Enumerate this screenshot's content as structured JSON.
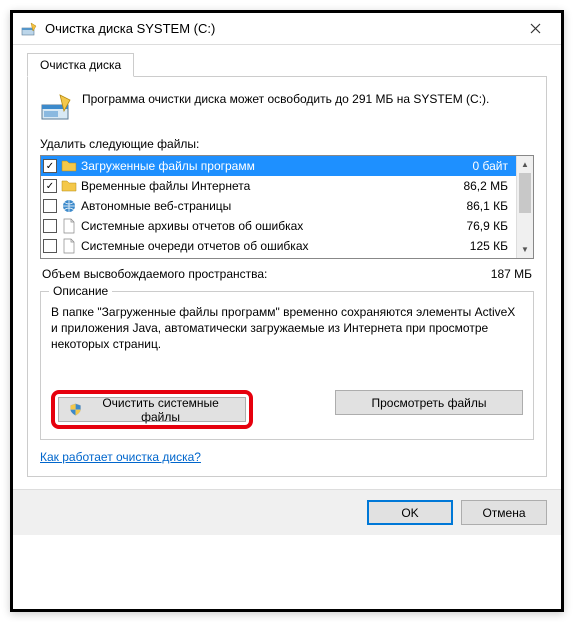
{
  "title": "Очистка диска SYSTEM (C:)",
  "tab_label": "Очистка диска",
  "intro": "Программа очистки диска может освободить до 291 МБ на SYSTEM (C:).",
  "files_label": "Удалить следующие файлы:",
  "files": [
    {
      "checked": true,
      "selected": true,
      "name": "Загруженные файлы программ",
      "size": "0 байт",
      "icon": "folder"
    },
    {
      "checked": true,
      "selected": false,
      "name": "Временные файлы Интернета",
      "size": "86,2 МБ",
      "icon": "folder"
    },
    {
      "checked": false,
      "selected": false,
      "name": "Автономные веб-страницы",
      "size": "86,1 КБ",
      "icon": "web"
    },
    {
      "checked": false,
      "selected": false,
      "name": "Системные архивы отчетов об ошибках",
      "size": "76,9 КБ",
      "icon": "file"
    },
    {
      "checked": false,
      "selected": false,
      "name": "Системные очереди отчетов об ошибках",
      "size": "125 КБ",
      "icon": "file"
    }
  ],
  "total_label": "Объем высвобождаемого пространства:",
  "total_value": "187 МБ",
  "desc_title": "Описание",
  "desc_text": "В папке \"Загруженные файлы программ\" временно сохраняются элементы ActiveX и приложения Java, автоматически загружаемые из Интернета при просмотре некоторых страниц.",
  "btn_clean_system": "Очистить системные файлы",
  "btn_view_files": "Просмотреть файлы",
  "link_text": "Как работает очистка диска?",
  "btn_ok": "OK",
  "btn_cancel": "Отмена"
}
